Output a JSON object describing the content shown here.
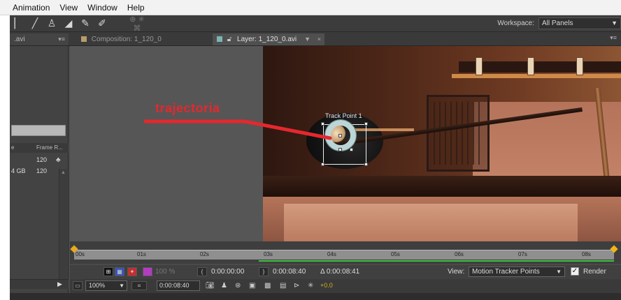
{
  "menu": {
    "items": [
      "Animation",
      "View",
      "Window",
      "Help"
    ]
  },
  "workspace": {
    "label": "Workspace:",
    "value": "All Panels"
  },
  "tabs": {
    "project_label": ".avi",
    "composition": "Composition: 1_120_0",
    "layer": "Layer: 1_120_0.avi"
  },
  "project": {
    "columns": [
      "e",
      "Frame R..."
    ],
    "rows": [
      {
        "size": "",
        "frame_rate": "120"
      },
      {
        "size": "4 GB",
        "frame_rate": "120"
      }
    ]
  },
  "viewer": {
    "annotation": "trajectoria",
    "track_point_label": "Track Point 1"
  },
  "timeline": {
    "ticks": [
      "00s",
      "01s",
      "02s",
      "03s",
      "04s",
      "05s",
      "06s",
      "07s",
      "08s"
    ]
  },
  "controls": {
    "in_time": "0:00:00:00",
    "out_time": "0:00:08:40",
    "duration": "Δ 0:00:08:41",
    "view_label": "View:",
    "view_value": "Motion Tracker Points",
    "render_label": "Render",
    "render_checked": true,
    "percent": "100 %",
    "zoom": "100%",
    "current_time": "0:00:08:40",
    "exposure": "+0.0"
  },
  "colors": {
    "annotation": "#e4282e",
    "tracker_ring": "#bcd6d8",
    "playhead": "#f0b418",
    "work_area": "#3ec43e"
  }
}
